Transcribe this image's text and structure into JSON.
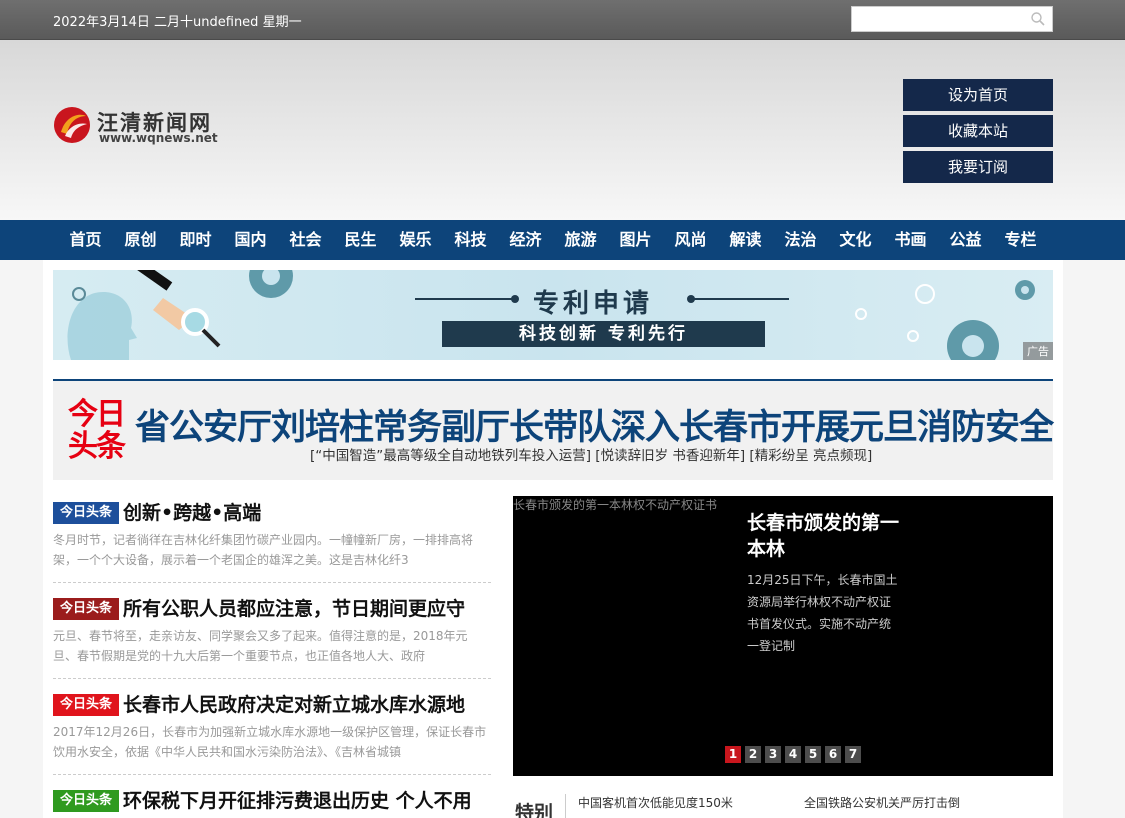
{
  "topbar": {
    "date": "2022年3月14日 二月十undefined 星期一",
    "search_placeholder": ""
  },
  "logo": {
    "name": "汪清新闻网",
    "domain": "www.wqnews.net"
  },
  "header_buttons": [
    "设为首页",
    "收藏本站",
    "我要订阅"
  ],
  "nav": [
    "首页",
    "原创",
    "即时",
    "国内",
    "社会",
    "民生",
    "娱乐",
    "科技",
    "经济",
    "旅游",
    "图片",
    "风尚",
    "解读",
    "法治",
    "文化",
    "书画",
    "公益",
    "专栏"
  ],
  "banner": {
    "title": "专利申请",
    "subtitle": "科技创新 专利先行",
    "ad_label": "广告"
  },
  "headline": {
    "badge_line1": "今日",
    "badge_line2": "头条",
    "title": "省公安厅刘培柱常务副厅长带队深入长春市开展元旦消防安全",
    "sublinks": "[“中国智造”最高等级全自动地铁列车投入运营] [悦读辞旧岁 书香迎新年] [精彩纷呈 亮点频现]"
  },
  "news": [
    {
      "tag": "今日头条",
      "tag_color": "#1d4f9b",
      "title": "创新•跨越•高端",
      "desc": "冬月时节，记者徜徉在吉林化纤集团竹碳产业园内。一幢幢新厂房，一排排高将架，一个个大设备，展示着一个老国企的雄浑之美。这是吉林化纤3"
    },
    {
      "tag": "今日头条",
      "tag_color": "#9b1c1c",
      "title": "所有公职人员都应注意，节日期间更应守",
      "desc": "元旦、春节将至，走亲访友、同学聚会又多了起来。值得注意的是，2018年元旦、春节假期是党的十九大后第一个重要节点，也正值各地人大、政府"
    },
    {
      "tag": "今日头条",
      "tag_color": "#e0141c",
      "title": "长春市人民政府决定对新立城水库水源地",
      "desc": "2017年12月26日，长春市为加强新立城水库水源地一级保护区管理，保证长春市饮用水安全，依据《中华人民共和国水污染防治法》、《吉林省城镇"
    },
    {
      "tag": "今日头条",
      "tag_color": "#2f9a1f",
      "title": "环保税下月开征排污费退出历史 个人不用",
      "desc": ""
    }
  ],
  "slideshow": {
    "image_alt": "长春市颁发的第一本林权不动产权证书",
    "title": "长春市颁发的第一本林",
    "desc": "12月25日下午，长春市国土资源局举行林权不动产权证书首发仪式。实施不动产统一登记制",
    "pages": [
      "1",
      "2",
      "3",
      "4",
      "5",
      "6",
      "7"
    ],
    "active_page": "1"
  },
  "special": {
    "label": "特别",
    "links": [
      "中国客机首次低能见度150米",
      "全国铁路公安机关严厉打击倒",
      "",
      ""
    ]
  }
}
